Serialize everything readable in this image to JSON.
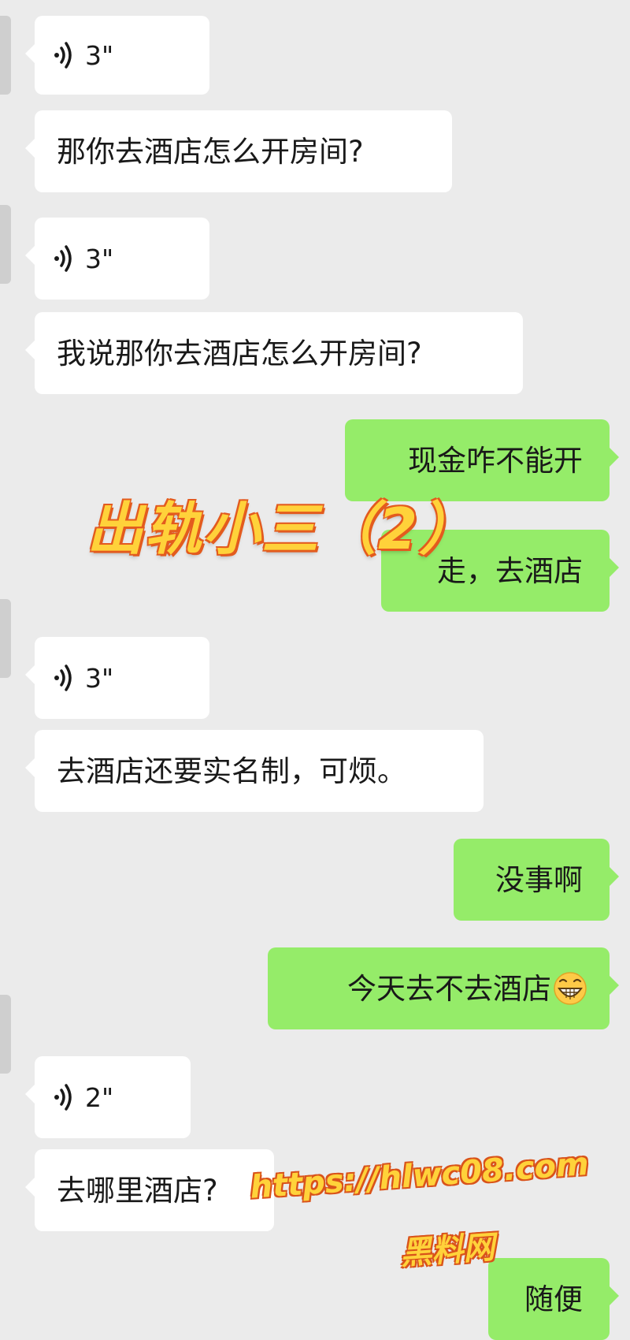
{
  "chat": {
    "messages": [
      {
        "from": "other",
        "type": "voice",
        "duration": "3\""
      },
      {
        "from": "other",
        "type": "text",
        "text": "那你去酒店怎么开房间?"
      },
      {
        "from": "other",
        "type": "voice",
        "duration": "3\""
      },
      {
        "from": "other",
        "type": "text",
        "text": "我说那你去酒店怎么开房间?"
      },
      {
        "from": "self",
        "type": "text",
        "text": "现金咋不能开"
      },
      {
        "from": "self",
        "type": "text",
        "text": "走，去酒店"
      },
      {
        "from": "other",
        "type": "voice",
        "duration": "3\""
      },
      {
        "from": "other",
        "type": "text",
        "text": "去酒店还要实名制，可烦。"
      },
      {
        "from": "self",
        "type": "text",
        "text": "没事啊"
      },
      {
        "from": "self",
        "type": "text",
        "text": "今天去不去酒店"
      },
      {
        "from": "other",
        "type": "voice",
        "duration": "2\""
      },
      {
        "from": "other",
        "type": "text",
        "text": "去哪里酒店?"
      },
      {
        "from": "self",
        "type": "text",
        "text": "随便"
      }
    ]
  },
  "overlay": {
    "title": "出轨小三（2）"
  },
  "watermark": {
    "url": "https://hlwc08.com",
    "name": "黑料网"
  },
  "colors": {
    "background": "#ebebeb",
    "incoming_bubble": "#ffffff",
    "outgoing_bubble": "#95ec69",
    "overlay_fill": "#ffd23a",
    "overlay_stroke": "#e35b1e"
  },
  "icons": {
    "voice": "voice-wave-icon",
    "avatar": "avatar",
    "emoji": "grinning-face-emoji"
  }
}
